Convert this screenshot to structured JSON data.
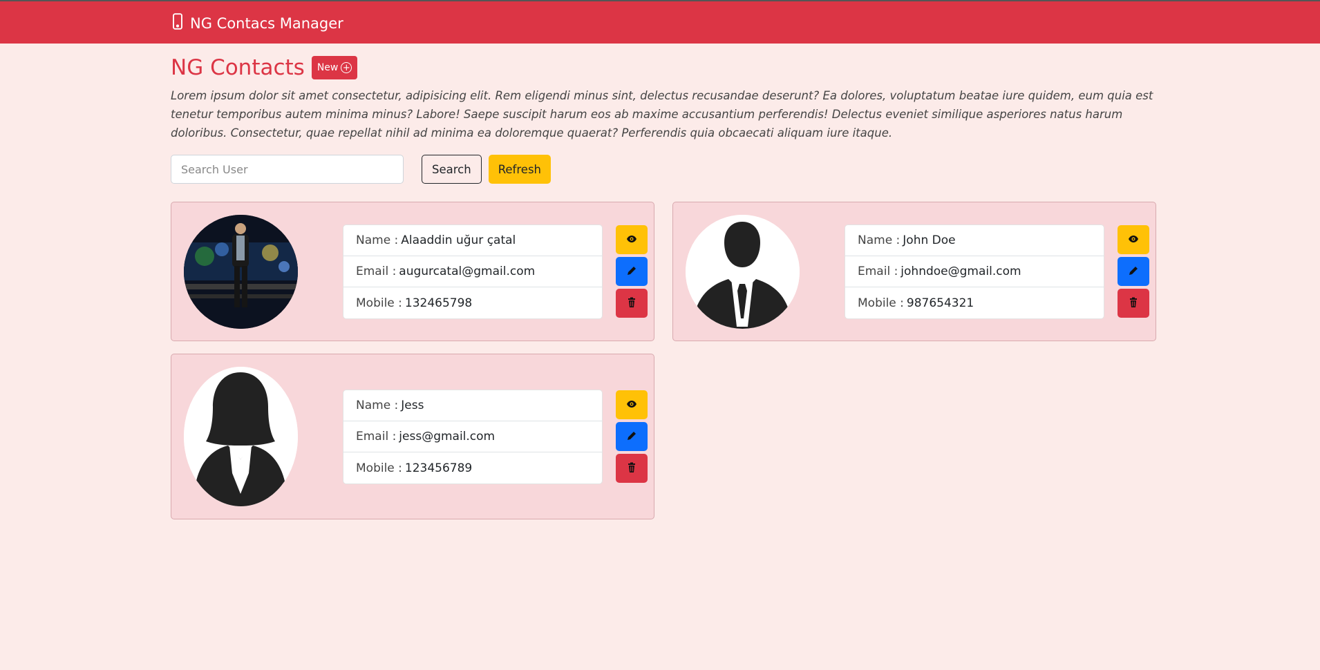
{
  "navbar": {
    "brand_label": "NG Contacs Manager",
    "brand_icon": "mobile-phone-icon"
  },
  "header": {
    "title": "NG Contacts",
    "new_button_label": "New",
    "intro": "Lorem ipsum dolor sit amet consectetur, adipisicing elit. Rem eligendi minus sint, delectus recusandae deserunt? Ea dolores, voluptatum beatae iure quidem, eum quia est tenetur temporibus autem minima minus? Labore! Saepe suscipit harum eos ab maxime accusantium perferendis! Delectus eveniet similique asperiores natus harum doloribus. Consectetur, quae repellat nihil ad minima ea doloremque quaerat? Perferendis quia obcaecati aliquam iure itaque."
  },
  "search": {
    "placeholder": "Search User",
    "value": "",
    "search_label": "Search",
    "refresh_label": "Refresh"
  },
  "labels": {
    "name": "Name :",
    "email": "Email :",
    "mobile": "Mobile :"
  },
  "contacts": [
    {
      "name": "Alaaddin uğur çatal",
      "email": "augurcatal@gmail.com",
      "mobile": "132465798",
      "avatar": "photo"
    },
    {
      "name": "John Doe",
      "email": "johndoe@gmail.com",
      "mobile": "987654321",
      "avatar": "male-silhouette"
    },
    {
      "name": "Jess",
      "email": "jess@gmail.com",
      "mobile": "123456789",
      "avatar": "female-silhouette"
    }
  ],
  "colors": {
    "navbar": "#dc3545",
    "background": "#fcebe9",
    "card": "#f8d7da",
    "view": "#ffc107",
    "edit": "#0d6efd",
    "delete": "#dc3545"
  }
}
